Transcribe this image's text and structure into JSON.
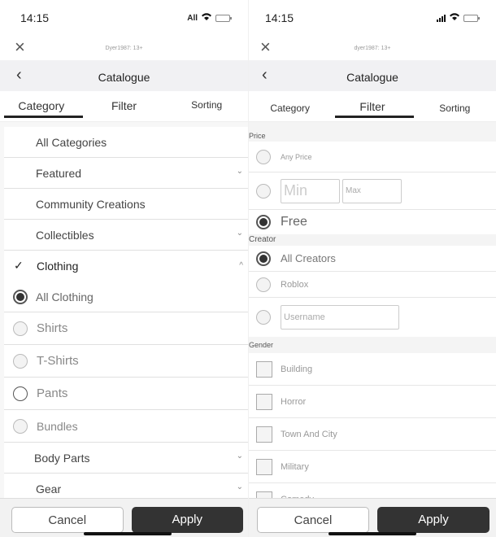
{
  "left": {
    "status": {
      "time": "14:15",
      "carrier": "All"
    },
    "user": "Dyer1987: 13+",
    "nav_title": "Catalogue",
    "tabs": [
      "Category",
      "Filter",
      "Sorting"
    ],
    "active_tab": "Category",
    "rows": [
      {
        "label": "All Categories"
      },
      {
        "label": "Featured",
        "chevron": "down"
      },
      {
        "label": "Community Creations"
      },
      {
        "label": "Collectibles",
        "chevron": "down"
      },
      {
        "label": "Clothing",
        "chevron": "up",
        "checked": true
      },
      {
        "label": "All Clothing",
        "selected": true
      },
      {
        "label": "Shirts"
      },
      {
        "label": "T-Shirts"
      },
      {
        "label": "Pants"
      },
      {
        "label": "Bundles"
      },
      {
        "label": "Body Parts",
        "chevron": "down"
      },
      {
        "label": "Gear",
        "chevron": "down"
      }
    ],
    "cancel_label": "Cancel",
    "apply_label": "Apply"
  },
  "right": {
    "status": {
      "time": "14:15"
    },
    "user": "dyer1987: 13+",
    "nav_title": "Catalogue",
    "tabs": [
      "Category",
      "Filter",
      "Sorting"
    ],
    "active_tab": "Filter",
    "price": {
      "heading": "Price",
      "any_label": "Any Price",
      "min_placeholder": "Min",
      "max_placeholder": "Max",
      "free_label": "Free",
      "selected": "Free"
    },
    "creator": {
      "heading": "Creator",
      "all_label": "All Creators",
      "roblox_label": "Roblox",
      "username_placeholder": "Username",
      "selected": "All Creators"
    },
    "gender": {
      "heading": "Gender",
      "options": [
        "Building",
        "Horror",
        "Town And City",
        "Military",
        "Comedy"
      ]
    },
    "cancel_label": "Cancel",
    "apply_label": "Apply"
  }
}
